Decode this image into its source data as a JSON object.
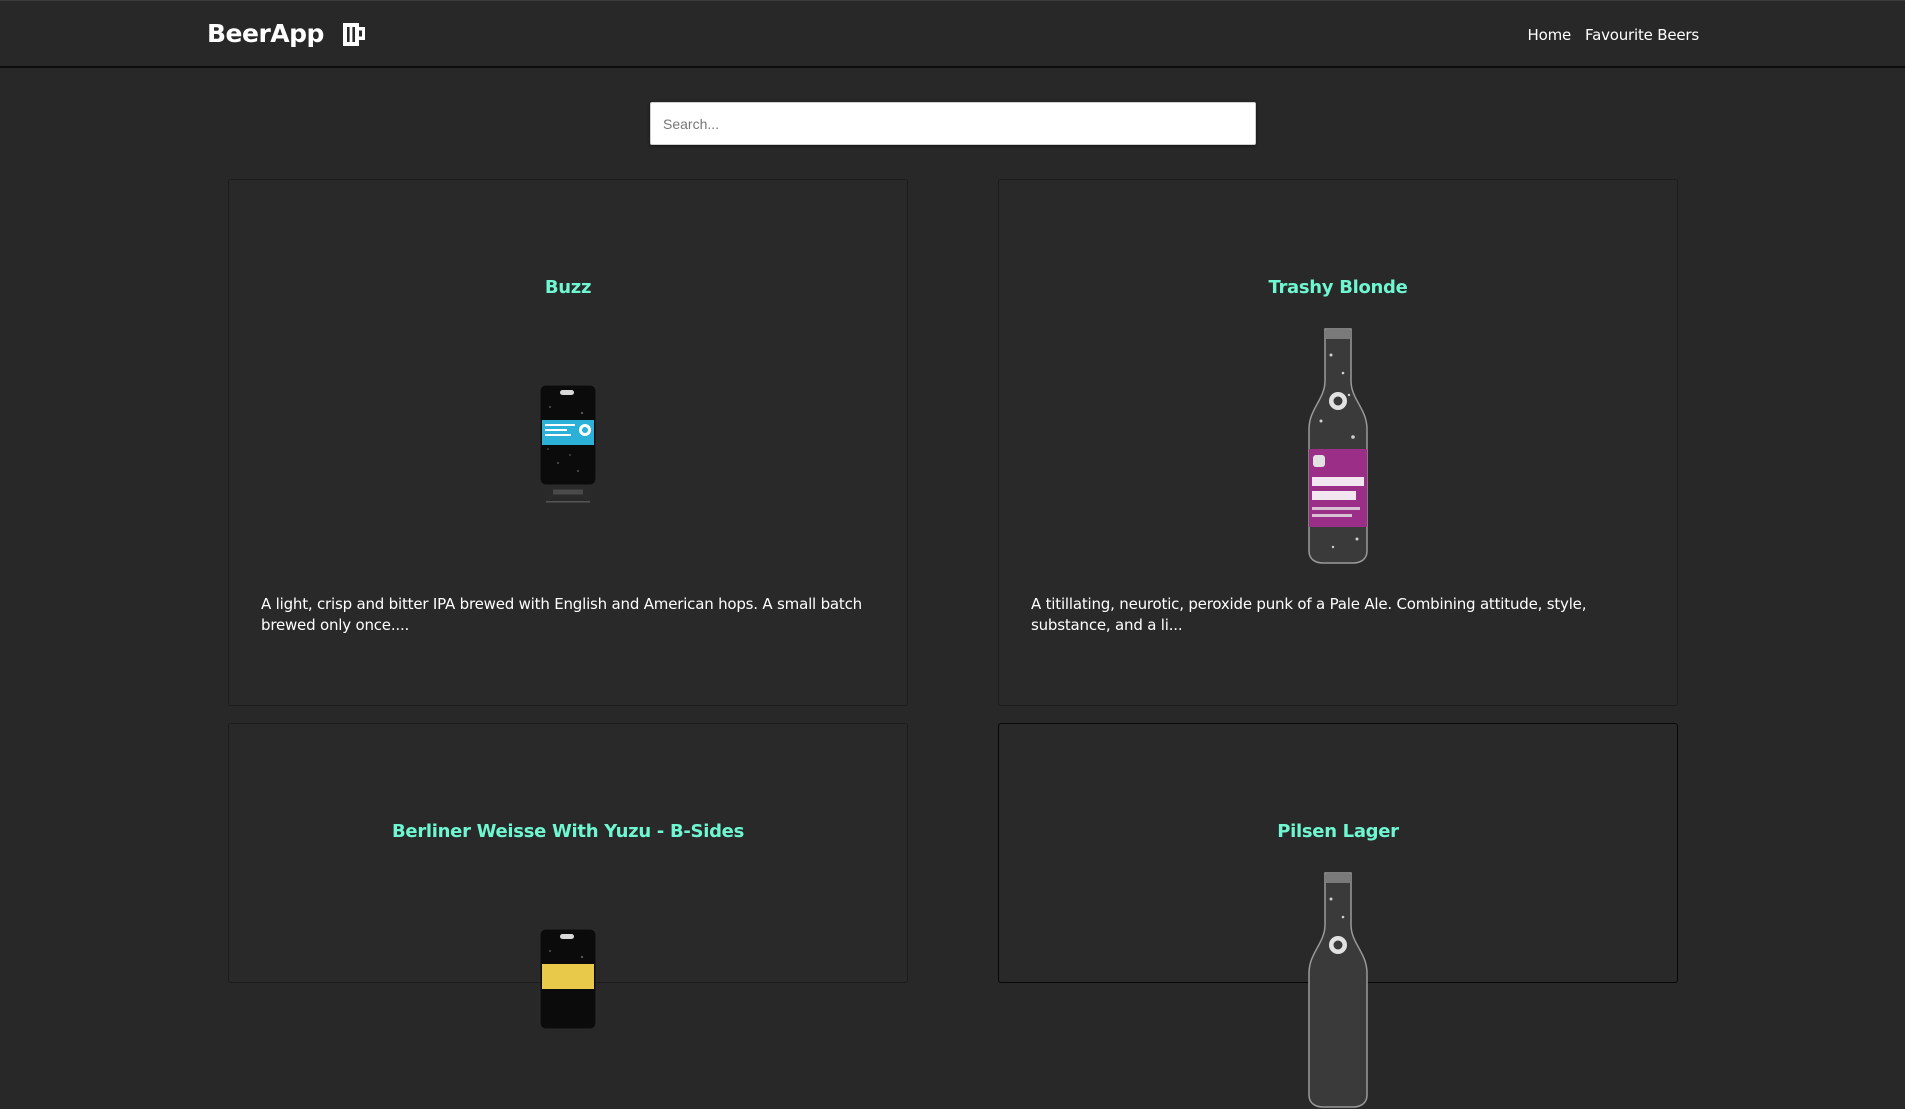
{
  "app": {
    "brand": "BeerApp",
    "brand_icon": "beer-mug-icon"
  },
  "nav": {
    "links": [
      "Home",
      "Favourite Beers"
    ]
  },
  "search": {
    "placeholder": "Search...",
    "value": ""
  },
  "colors": {
    "background": "#282828",
    "accent": "#6ff7d1",
    "text": "#ffffff"
  },
  "beers": [
    {
      "name": "Buzz",
      "description": "A light, crisp and bitter IPA brewed with English and American hops. A small batch brewed only once....",
      "image": "keg-can-icon"
    },
    {
      "name": "Trashy Blonde",
      "description": "A titillating, neurotic, peroxide punk of a Pale Ale. Combining attitude, style, substance, and a li...",
      "image": "beer-bottle-icon"
    },
    {
      "name": "Berliner Weisse With Yuzu - B-Sides",
      "description": "",
      "image": "keg-can-icon"
    },
    {
      "name": "Pilsen Lager",
      "description": "",
      "image": "beer-bottle-icon"
    }
  ]
}
